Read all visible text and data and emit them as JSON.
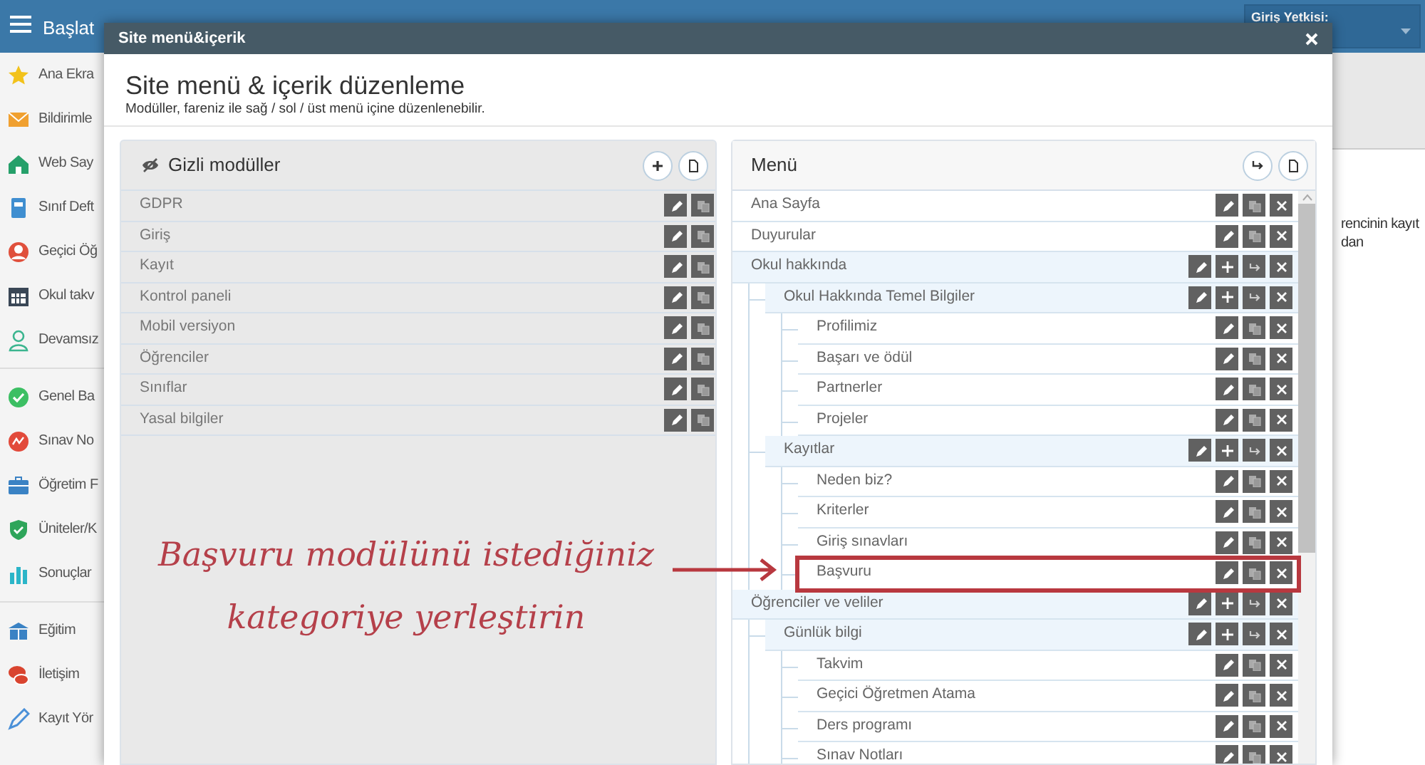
{
  "topbar": {
    "title": "Başlat",
    "role_label": "Giriş Yetkisi:"
  },
  "sidebar": {
    "groups": [
      {
        "items": [
          "Ana Ekra",
          "Bildirimle",
          "Web Say",
          "Sınıf Deft",
          "Geçici Öğ",
          "Okul takv",
          "Devamsız"
        ]
      },
      {
        "items": [
          "Genel Ba",
          "Sınav No",
          "Öğretim F",
          "Üniteler/K",
          "Sonuçlar"
        ]
      },
      {
        "items": [
          "Eğitim",
          "İletişim",
          "Kayıt Yör"
        ]
      }
    ]
  },
  "background_text": [
    "rencinin kayıt",
    "dan"
  ],
  "modal": {
    "title": "Site menü&içerik",
    "heading": "Site menü & içerik düzenleme",
    "subtitle": "Modüller, fareniz ile sağ / sol / üst menü içine düzenlenebilir.",
    "hidden_modules": {
      "title": "Gizli modüller",
      "items": [
        "GDPR",
        "Giriş",
        "Kayıt",
        "Kontrol paneli",
        "Mobil versiyon",
        "Öğrenciler",
        "Sınıflar",
        "Yasal bilgiler"
      ]
    },
    "menu": {
      "title": "Menü",
      "items": [
        {
          "label": "Ana Sayfa",
          "kind": "page",
          "highlighted": false
        },
        {
          "label": "Duyurular",
          "kind": "page",
          "highlighted": false
        },
        {
          "label": "Okul hakkında",
          "kind": "category",
          "highlighted": false,
          "children": [
            {
              "label": "Okul Hakkında Temel Bilgiler",
              "kind": "category",
              "highlighted": false,
              "children": [
                {
                  "label": "Profilimiz",
                  "kind": "page",
                  "highlighted": false
                },
                {
                  "label": "Başarı ve ödül",
                  "kind": "page",
                  "highlighted": false
                },
                {
                  "label": "Partnerler",
                  "kind": "page",
                  "highlighted": false
                },
                {
                  "label": "Projeler",
                  "kind": "page",
                  "highlighted": false
                }
              ]
            },
            {
              "label": "Kayıtlar",
              "kind": "category",
              "highlighted": false,
              "children": [
                {
                  "label": "Neden biz?",
                  "kind": "page",
                  "highlighted": false
                },
                {
                  "label": "Kriterler",
                  "kind": "page",
                  "highlighted": false
                },
                {
                  "label": "Giriş sınavları",
                  "kind": "page",
                  "highlighted": false
                },
                {
                  "label": "Başvuru",
                  "kind": "page",
                  "highlighted": true
                }
              ]
            }
          ]
        },
        {
          "label": "Öğrenciler ve veliler",
          "kind": "category",
          "highlighted": false,
          "children": [
            {
              "label": "Günlük bilgi",
              "kind": "category",
              "highlighted": false,
              "children": [
                {
                  "label": "Takvim",
                  "kind": "page",
                  "highlighted": false
                },
                {
                  "label": "Geçici Öğretmen Atama",
                  "kind": "page",
                  "highlighted": false
                },
                {
                  "label": "Ders programı",
                  "kind": "page",
                  "highlighted": false
                },
                {
                  "label": "Sınav Notları",
                  "kind": "page",
                  "highlighted": false
                }
              ]
            }
          ]
        }
      ]
    }
  },
  "annotation": {
    "lines": [
      "Başvuru modülünü istediğiniz",
      "kategoriye yerleştirin"
    ]
  }
}
